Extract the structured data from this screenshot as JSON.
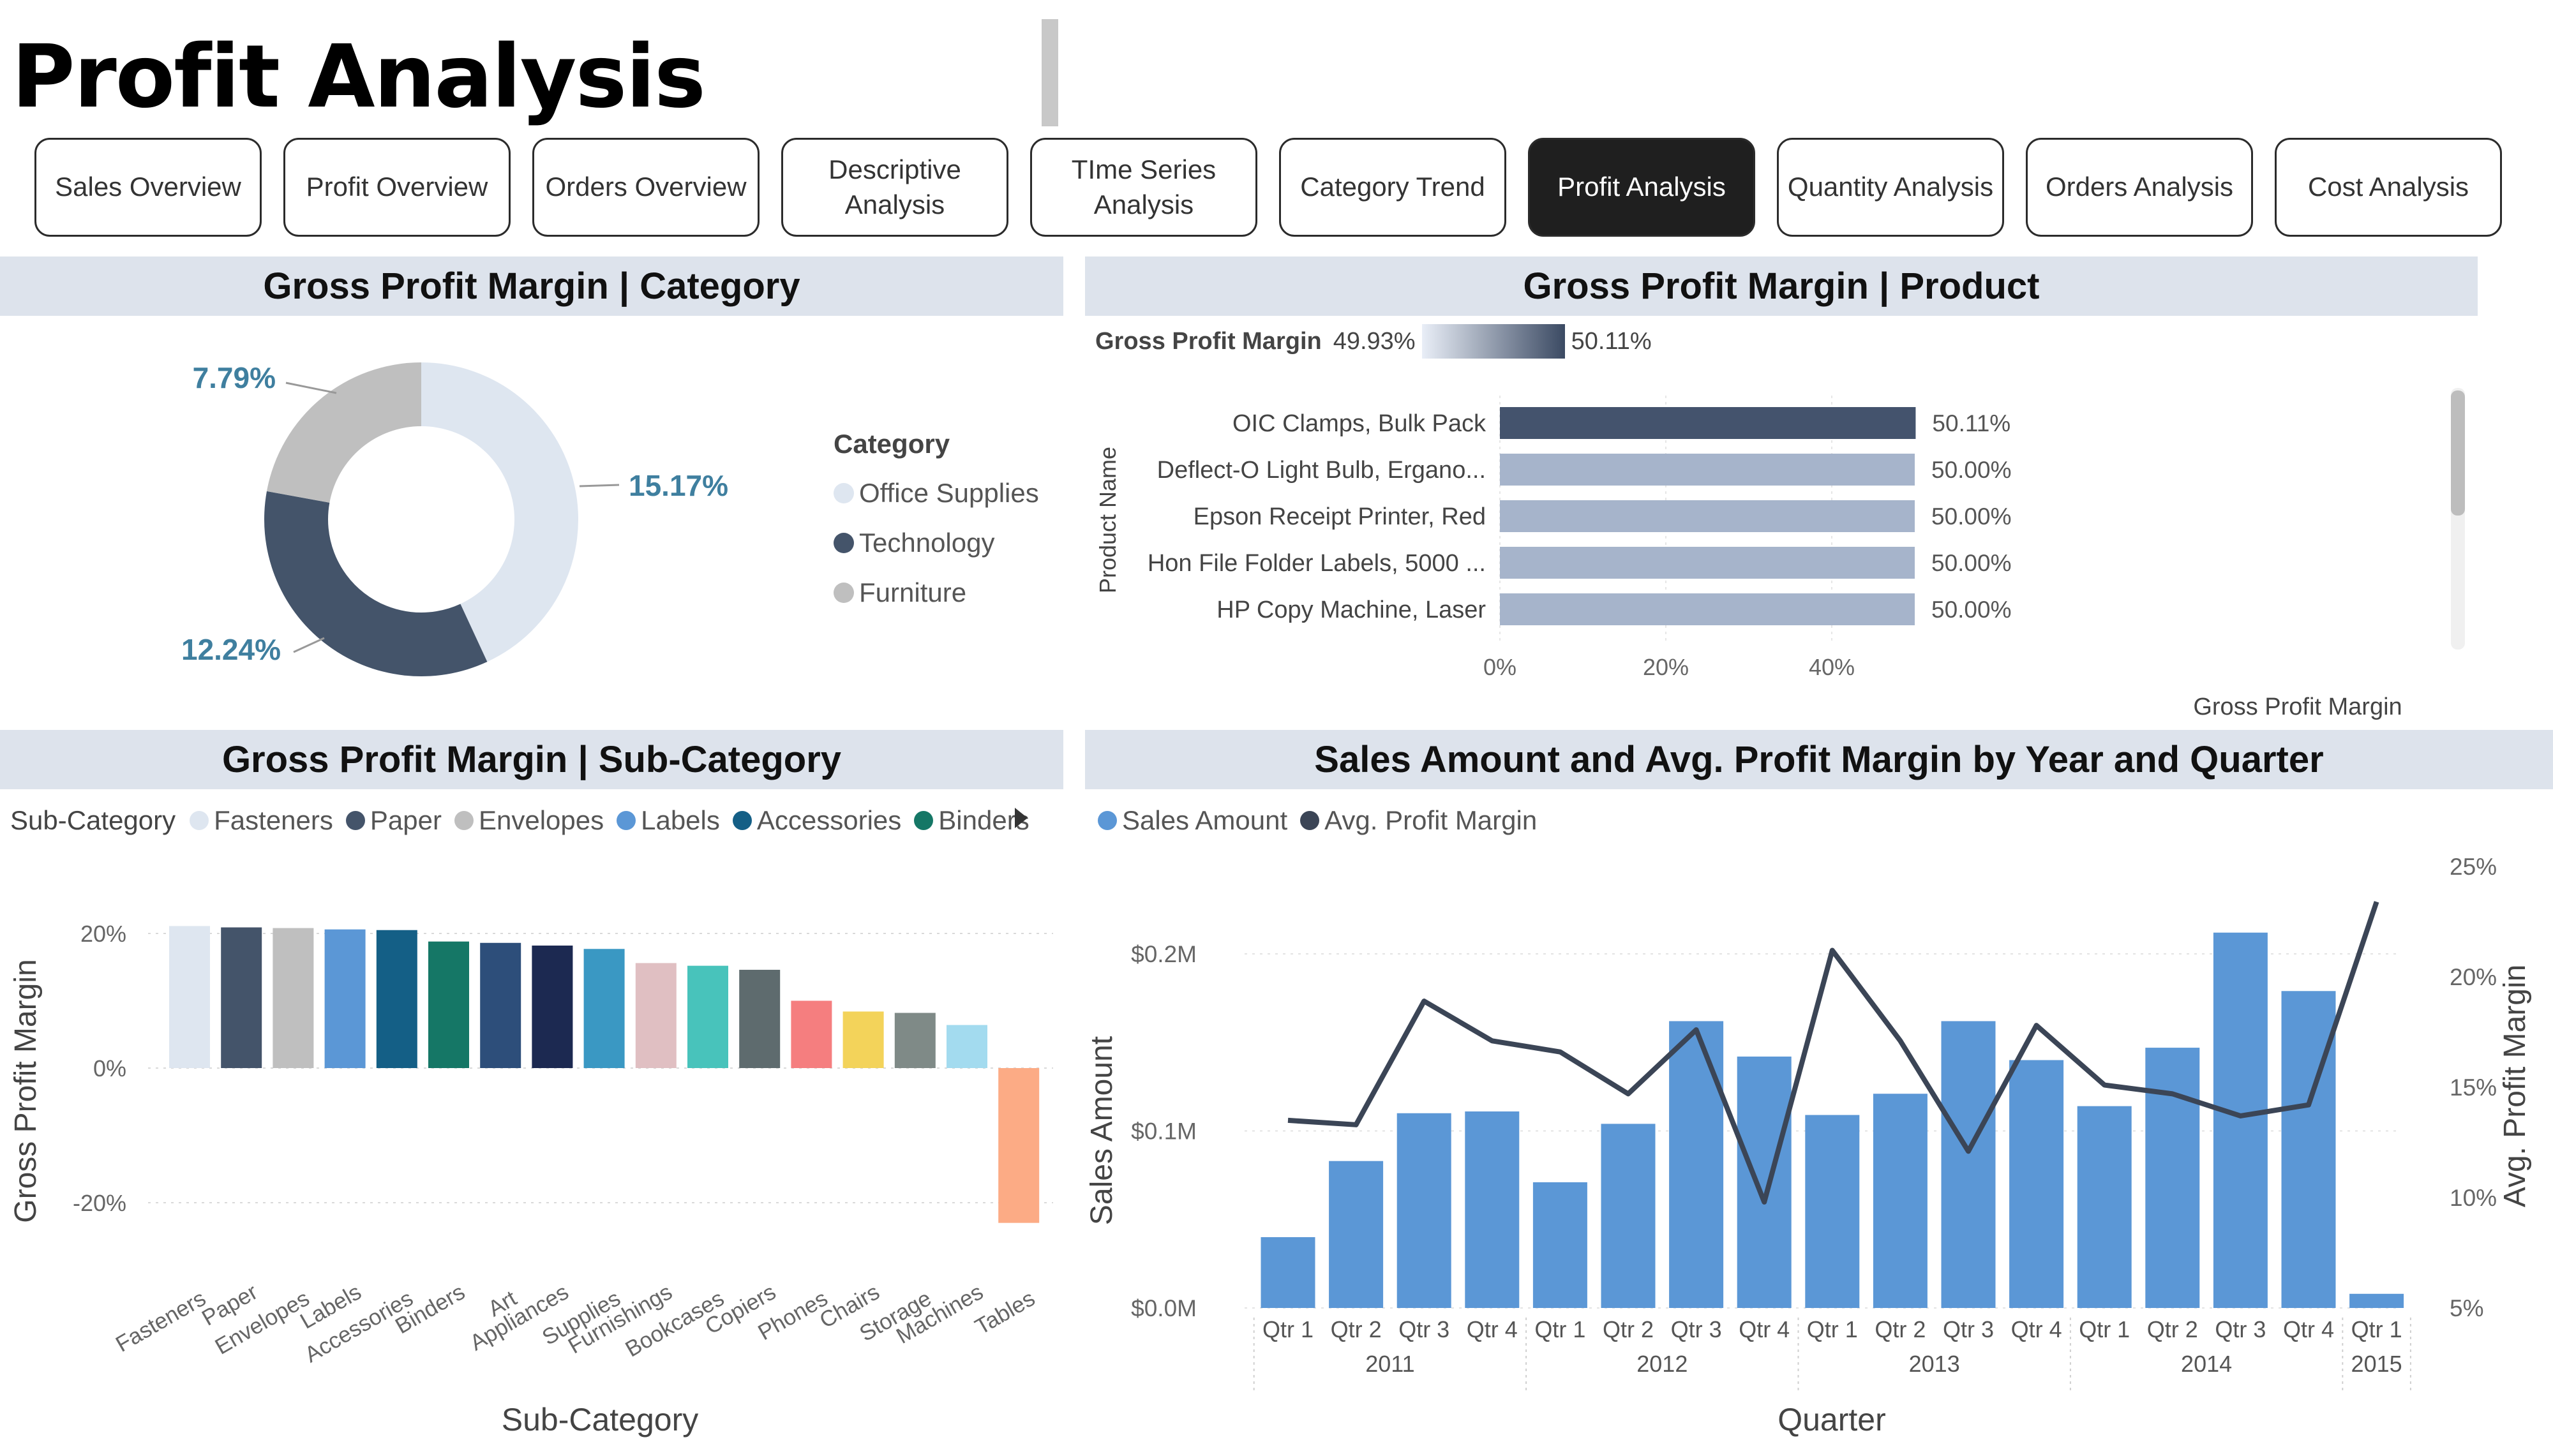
{
  "page": {
    "title": "Profit Analysis"
  },
  "nav": {
    "buttons": [
      {
        "label": "Sales Overview",
        "active": false
      },
      {
        "label": "Profit Overview",
        "active": false
      },
      {
        "label": "Orders Overview",
        "active": false
      },
      {
        "label": "Descriptive\nAnalysis",
        "active": false
      },
      {
        "label": "TIme Series\nAnalysis",
        "active": false
      },
      {
        "label": "Category Trend",
        "active": false
      },
      {
        "label": "Profit Analysis",
        "active": true
      },
      {
        "label": "Quantity Analysis",
        "active": false
      },
      {
        "label": "Orders Analysis",
        "active": false
      },
      {
        "label": "Cost Analysis",
        "active": false
      }
    ]
  },
  "panels": {
    "category": {
      "title": "Gross Profit Margin | Category"
    },
    "product": {
      "title": "Gross Profit Margin | Product"
    },
    "subcategory": {
      "title": "Gross Profit Margin | Sub-Category"
    },
    "yearquarter": {
      "title": "Sales Amount and Avg. Profit Margin by Year and Quarter"
    }
  },
  "colors": {
    "office_supplies": "#dee6f0",
    "technology": "#44546a",
    "furniture": "#bfbfbf",
    "sales_bar": "#5b97d6",
    "margin_line": "#3b4556",
    "product_top_bar": "#44536d",
    "product_bar": "#a6b4cb"
  },
  "chart_data": [
    {
      "type": "pie",
      "legend_title": "Category",
      "legend_position": "right",
      "slices": [
        {
          "label": "Office Supplies",
          "value": 15.17,
          "value_label": "15.17%",
          "color": "#dee6f0"
        },
        {
          "label": "Technology",
          "value": 12.24,
          "value_label": "12.24%",
          "color": "#44546a"
        },
        {
          "label": "Furniture",
          "value": 7.79,
          "value_label": "7.79%",
          "color": "#bfbfbf"
        }
      ]
    },
    {
      "type": "bar",
      "orientation": "horizontal",
      "ylabel": "Product Name",
      "xlabel": "Gross Profit Margin",
      "xlim": [
        0,
        50.11
      ],
      "xticks": [
        "0%",
        "20%",
        "40%"
      ],
      "xtick_values": [
        0,
        20,
        40
      ],
      "color_legend": {
        "title": "Gross Profit Margin",
        "min_label": "49.93%",
        "max_label": "50.11%"
      },
      "categories": [
        "OIC Clamps, Bulk Pack",
        "Deflect-O Light Bulb, Ergano...",
        "Epson Receipt Printer, Red",
        "Hon File Folder Labels, 5000 ...",
        "HP Copy Machine, Laser"
      ],
      "values": [
        50.11,
        50.0,
        50.0,
        50.0,
        50.0
      ],
      "value_labels": [
        "50.11%",
        "50.00%",
        "50.00%",
        "50.00%",
        "50.00%"
      ]
    },
    {
      "type": "bar",
      "legend_title": "Sub-Category",
      "legend_position": "top-left",
      "legend_items": [
        {
          "label": "Fasteners",
          "color": "#dee6f0"
        },
        {
          "label": "Paper",
          "color": "#44546a"
        },
        {
          "label": "Envelopes",
          "color": "#bfbfbf"
        },
        {
          "label": "Labels",
          "color": "#5b97d6"
        },
        {
          "label": "Accessories",
          "color": "#145f86"
        },
        {
          "label": "Binders",
          "color": "#157766"
        }
      ],
      "xlabel": "Sub-Category",
      "ylabel": "Gross Profit Margin",
      "ylim": [
        -25,
        22
      ],
      "yticks": [
        "20%",
        "0%",
        "-20%"
      ],
      "ytick_values": [
        20,
        0,
        -20
      ],
      "categories": [
        "Fasteners",
        "Paper",
        "Envelopes",
        "Labels",
        "Accessories",
        "Binders",
        "Art",
        "Appliances",
        "Supplies",
        "Furnishings",
        "Bookcases",
        "Copiers",
        "Phones",
        "Chairs",
        "Storage",
        "Machines",
        "Tables"
      ],
      "values": [
        21.1,
        20.9,
        20.8,
        20.6,
        20.5,
        18.8,
        18.6,
        18.2,
        17.7,
        15.6,
        15.2,
        14.6,
        10.0,
        8.4,
        8.2,
        6.4,
        -23.0
      ],
      "colors": [
        "#dee6f0",
        "#44546a",
        "#bfbfbf",
        "#5b97d6",
        "#145f86",
        "#157766",
        "#2d4e7a",
        "#1c2951",
        "#3a98c3",
        "#e0bfc2",
        "#48c3bb",
        "#5e6b6e",
        "#f57e7f",
        "#f3d35a",
        "#7f8a87",
        "#a3dbef",
        "#fcab85"
      ]
    },
    {
      "type": "bar",
      "combo": "bar+line",
      "legend_position": "top-left",
      "series": [
        {
          "name": "Sales Amount",
          "type": "bar",
          "axis": "left",
          "color": "#5b97d6",
          "values": [
            0.04,
            0.083,
            0.11,
            0.111,
            0.071,
            0.104,
            0.162,
            0.142,
            0.109,
            0.121,
            0.162,
            0.14,
            0.114,
            0.147,
            0.212,
            0.179,
            0.008
          ]
        },
        {
          "name": "Avg. Profit Margin",
          "type": "line",
          "axis": "right",
          "color": "#3b4556",
          "values": [
            13.5,
            13.3,
            18.9,
            17.1,
            16.6,
            14.7,
            17.6,
            9.8,
            21.2,
            17.1,
            12.1,
            17.8,
            15.1,
            14.7,
            13.7,
            14.2,
            23.4
          ]
        }
      ],
      "categories": [
        "Qtr 1",
        "Qtr 2",
        "Qtr 3",
        "Qtr 4",
        "Qtr 1",
        "Qtr 2",
        "Qtr 3",
        "Qtr 4",
        "Qtr 1",
        "Qtr 2",
        "Qtr 3",
        "Qtr 4",
        "Qtr 1",
        "Qtr 2",
        "Qtr 3",
        "Qtr 4",
        "Qtr 1"
      ],
      "years": [
        {
          "label": "2011",
          "quarters": 4
        },
        {
          "label": "2012",
          "quarters": 4
        },
        {
          "label": "2013",
          "quarters": 4
        },
        {
          "label": "2014",
          "quarters": 4
        },
        {
          "label": "2015",
          "quarters": 1
        }
      ],
      "xlabel": "Quarter",
      "ylabel": "Sales Amount",
      "y2label": "Avg. Profit Margin",
      "ylim": [
        0,
        0.25
      ],
      "yticks": [
        "$0.0M",
        "$0.1M",
        "$0.2M"
      ],
      "ytick_values": [
        0,
        0.1,
        0.2
      ],
      "y2lim": [
        5,
        25
      ],
      "y2ticks": [
        "5%",
        "10%",
        "15%",
        "20%",
        "25%"
      ],
      "y2tick_values": [
        5,
        10,
        15,
        20,
        25
      ]
    }
  ]
}
